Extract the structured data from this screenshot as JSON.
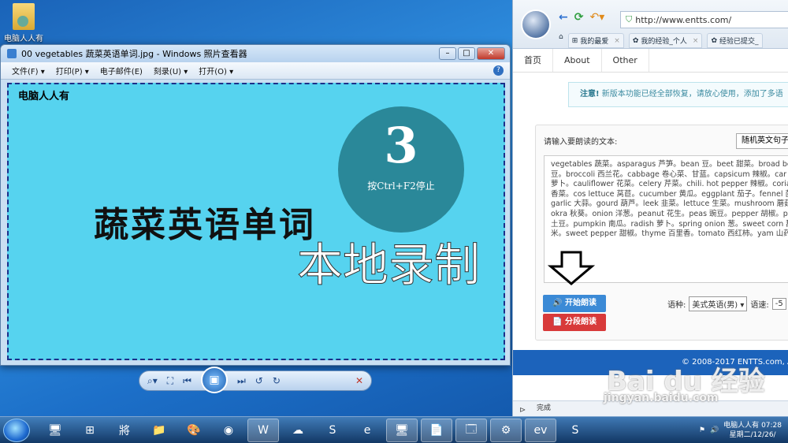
{
  "desktop": {
    "icon_label": "电脑人人有"
  },
  "viewer": {
    "title": "00 vegetables 蔬菜英语单词.jpg - Windows 照片查看器",
    "menu": [
      "文件(F) ▾",
      "打印(P) ▾",
      "电子邮件(E)",
      "刻录(U) ▾",
      "打开(O) ▾"
    ],
    "help": "?",
    "photo": {
      "watermark": "电脑人人有",
      "countdown_number": "3",
      "countdown_hint": "按Ctrl+F2停止",
      "title": "蔬菜英语单词",
      "subtitle": "本地录制"
    },
    "controls": {
      "zoom": "⌕▾",
      "fit": "⛶",
      "prev": "⏮",
      "play": "▣",
      "next": "⏭",
      "rotate_ccw": "↺",
      "rotate_cw": "↻",
      "delete": "✕"
    }
  },
  "browser": {
    "url": "http://www.entts.com/",
    "tabs": [
      {
        "label": "我的最爱"
      },
      {
        "label": "我的经验_个人"
      },
      {
        "label": "经验已提交_"
      }
    ],
    "site_nav": [
      "首页",
      "About",
      "Other"
    ],
    "notice": {
      "strong": "注意!",
      "text": " 新版本功能已经全部恢复，请放心使用，添加了多语"
    },
    "prompt": "请输入要朗读的文本:",
    "random_select": "随机英文句子",
    "text_lines": [
      "vegetables 蔬菜。asparagus 芦笋。bean 豆。beet 甜菜。broad be",
      "豆。broccoli 西兰花。cabbage 卷心菜、甘蓝。capsicum 辣椒。car",
      "萝卜。cauliflower 花菜。celery 芹菜。chili. hot pepper 辣椒。coria",
      "香菜。cos lettuce 莴苣。cucumber 黄瓜。eggplant 茄子。fennel 茴",
      "garlic 大蒜。gourd 葫芦。leek 韭菜。lettuce 生菜。mushroom 蘑菇",
      "okra 秋葵。onion 洋葱。peanut 花生。peas 豌豆。pepper 胡椒。p",
      "土豆。pumpkin 南瓜。radish 萝卜。spring onion 葱。sweet corn 甜",
      "米。sweet pepper 甜椒。thyme 百里香。tomato 西红柿。yam 山药"
    ],
    "btn_play": "🔊 开始朗读",
    "btn_segment": "📄 分段朗读",
    "lang_label": "语种:",
    "lang_value": "美式英语(男) ▾",
    "speed_label": "语速:",
    "speed_value": "-5",
    "footer": "© 2008-2017 ENTTS.com, All",
    "status": "完成"
  },
  "watermark": {
    "baidu": "Bai du 经验",
    "url": "jingyan.baidu.com"
  },
  "taskbar": {
    "apps": [
      "🖥",
      "⊞",
      "將",
      "📁",
      "🎨",
      "◉",
      "W",
      "☁",
      "S",
      "e",
      "🖥",
      "📄",
      "🗔",
      "⚙",
      "ev",
      "S"
    ],
    "tray_user": "电脑人人有",
    "time": "07:28",
    "date": "星期二/12/26/"
  }
}
